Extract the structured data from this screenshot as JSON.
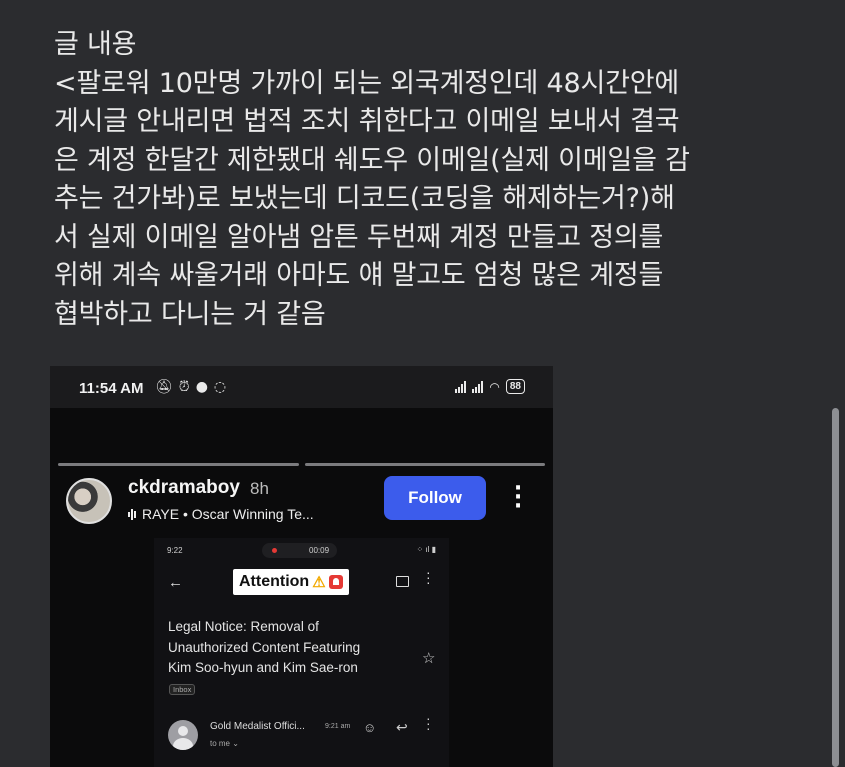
{
  "post": {
    "lines": [
      "글 내용",
      "<팔로워 10만명 가까이 되는 외국계정인데 48시간안에",
      "게시글 안내리면 법적 조치 취한다고 이메일 보내서 결국",
      "은 계정 한달간 제한됐대 쉐도우 이메일(실제 이메일을 감",
      "추는 건가봐)로 보냈는데 디코드(코딩을 해제하는거?)해",
      "서 실제 이메일 알아냄 암튼 두번째 계정 만들고 정의를",
      "위해 계속 싸울거래 아마도 얘 말고도 엄청 많은 계정들",
      "협박하고 다니는 거 같음"
    ]
  },
  "screenshot": {
    "status": {
      "time": "11:54 AM",
      "battery": "88"
    },
    "story": {
      "username": "ckdramaboy",
      "time_ago": "8h",
      "music": "RAYE • Oscar Winning Te...",
      "follow_label": "Follow"
    },
    "email": {
      "time": "9:22",
      "rec_time": "00:09",
      "attention": "Attention",
      "subject_lines": [
        "Legal Notice: Removal of",
        "Unauthorized Content Featuring",
        "Kim Soo-hyun and Kim Sae-ron"
      ],
      "inbox_tag": "Inbox",
      "sender": "Gold Medalist Offici...",
      "sent_time": "9:21 am",
      "to": "to me"
    }
  }
}
